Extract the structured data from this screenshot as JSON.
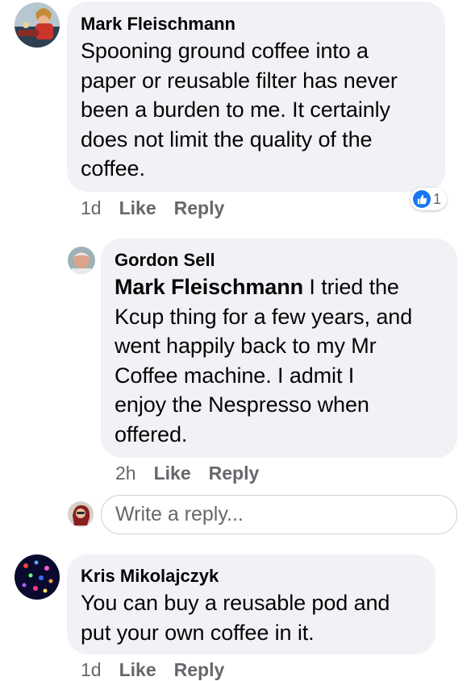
{
  "comments": [
    {
      "author": "Mark Fleischmann",
      "text_lines": [
        "Spooning ground coffee into a",
        "paper or reusable filter has never",
        "been a burden to me. It certainly",
        "does not limit the quality of the",
        "coffee."
      ],
      "time": "1d",
      "like_label": "Like",
      "reply_label": "Reply",
      "reaction_count": "1",
      "reaction_icon": "thumbs-up-icon"
    },
    {
      "author": "Gordon Sell",
      "mention": "Mark Fleischmann",
      "text_lines": [
        " I tried the",
        "Kcup thing for a few years, and",
        "went happily back to my Mr",
        "Coffee machine. I admit I",
        "enjoy the Nespresso when",
        "offered."
      ],
      "time": "2h",
      "like_label": "Like",
      "reply_label": "Reply"
    },
    {
      "author": "Kris Mikolajczyk",
      "text_lines": [
        "You can buy a reusable pod and",
        "put your own coffee in it."
      ],
      "time": "1d",
      "like_label": "Like",
      "reply_label": "Reply"
    }
  ],
  "reply_box": {
    "placeholder": "Write a reply..."
  },
  "colors": {
    "bubble": "#f0f2f5",
    "secondary_text": "#65676b",
    "like_blue": "#1877f2"
  }
}
